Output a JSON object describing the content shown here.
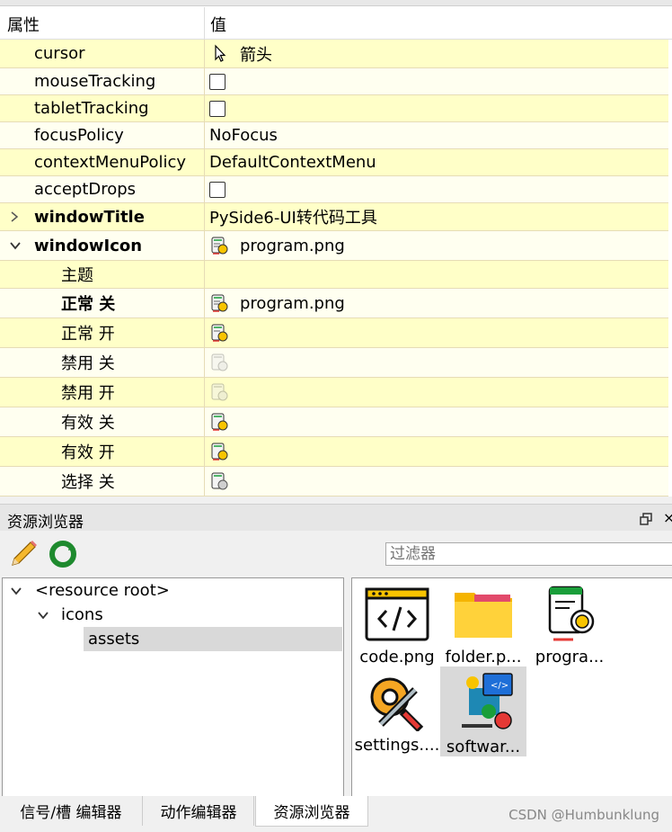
{
  "property_editor": {
    "header": {
      "col_property": "属性",
      "col_value": "值"
    },
    "rows": {
      "cursor": {
        "name": "cursor",
        "value": "箭头"
      },
      "mouseTracking": {
        "name": "mouseTracking",
        "checked": false
      },
      "tabletTracking": {
        "name": "tabletTracking",
        "checked": false
      },
      "focusPolicy": {
        "name": "focusPolicy",
        "value": "NoFocus"
      },
      "contextMenuPolicy": {
        "name": "contextMenuPolicy",
        "value": "DefaultContextMenu"
      },
      "acceptDrops": {
        "name": "acceptDrops",
        "checked": false
      },
      "windowTitle": {
        "name": "windowTitle",
        "value": "PySide6-UI转代码工具"
      },
      "windowIcon": {
        "name": "windowIcon",
        "value": "program.png"
      },
      "theme": {
        "name": "主题",
        "value": ""
      },
      "normal_off": {
        "name": "正常 关",
        "value": "program.png"
      },
      "normal_on": {
        "name": "正常 开"
      },
      "disabled_off": {
        "name": "禁用 关"
      },
      "disabled_on": {
        "name": "禁用 开"
      },
      "active_off": {
        "name": "有效 关"
      },
      "active_on": {
        "name": "有效 开"
      },
      "selected_off": {
        "name": "选择 关"
      }
    }
  },
  "resource_browser": {
    "title": "资源浏览器",
    "filter_placeholder": "过滤器",
    "tree": {
      "root": "<resource root>",
      "child": "icons",
      "grandchild": "assets"
    },
    "files": [
      {
        "label": "code.png"
      },
      {
        "label": "folder.p..."
      },
      {
        "label": "progra..."
      },
      {
        "label": "settings...."
      },
      {
        "label": "softwar..."
      }
    ]
  },
  "bottom_tabs": [
    "信号/槽 编辑器",
    "动作编辑器",
    "资源浏览器"
  ],
  "watermark": "CSDN @Humbunklung"
}
